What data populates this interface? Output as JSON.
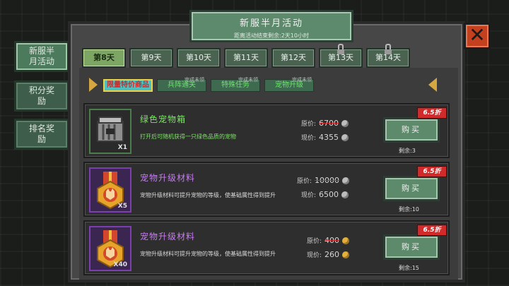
{
  "title": {
    "main": "新服半月活动",
    "sub": "距离活动结束剩余:2天10小时"
  },
  "side_buttons": [
    {
      "label": "新服半\n月活动",
      "active": true
    },
    {
      "label": "积分奖\n励",
      "active": false
    },
    {
      "label": "排名奖\n励",
      "active": false
    }
  ],
  "tabs": [
    {
      "label": "第8天",
      "active": true,
      "locked": false
    },
    {
      "label": "第9天",
      "active": false,
      "locked": false
    },
    {
      "label": "第10天",
      "active": false,
      "locked": false
    },
    {
      "label": "第11天",
      "active": false,
      "locked": false
    },
    {
      "label": "第12天",
      "active": false,
      "locked": false
    },
    {
      "label": "第13天",
      "active": false,
      "locked": true
    },
    {
      "label": "第14天",
      "active": false,
      "locked": true
    }
  ],
  "subtabs": [
    {
      "label": "限量特价商品",
      "active": true,
      "mini": ""
    },
    {
      "label": "兵阵通关",
      "active": false,
      "mini": "完成未领"
    },
    {
      "label": "特殊任务",
      "active": false,
      "mini": "完成未领"
    },
    {
      "label": "宠物升级",
      "active": false,
      "mini": "完成未领"
    }
  ],
  "items": [
    {
      "name": "绿色宠物箱",
      "desc": "打开后可随机获得一只绿色品质的宠物",
      "icon": "pet-crate-icon",
      "count": "X1",
      "orig_label": "原价:",
      "orig_price": "6700",
      "now_label": "现价:",
      "now_price": "4355",
      "coin": "silver",
      "discount": "6.5折",
      "buy": "购买",
      "stock": "剩余:3",
      "color": "green"
    },
    {
      "name": "宠物升级材料",
      "desc": "宠物升级材料可提升宠物的等级，使基础属性得到提升",
      "icon": "pet-medal-icon",
      "count": "X5",
      "orig_label": "原价:",
      "orig_price": "10000",
      "now_label": "现价:",
      "now_price": "6500",
      "coin": "silver",
      "discount": "6.5折",
      "buy": "购买",
      "stock": "剩余:10",
      "color": "purple"
    },
    {
      "name": "宠物升级材料",
      "desc": "宠物升级材料可提升宠物的等级，使基础属性得到提升",
      "icon": "pet-medal-icon",
      "count": "X40",
      "orig_label": "原价:",
      "orig_price": "400",
      "now_label": "现价:",
      "now_price": "260",
      "coin": "gold",
      "discount": "6.5折",
      "buy": "购买",
      "stock": "剩余:15",
      "color": "purple"
    }
  ],
  "colors": {
    "accent_green": "#5d8a6c",
    "discount_red": "#d12a2a",
    "name_green": "#7fe26a",
    "name_purple": "#c67cf0"
  }
}
